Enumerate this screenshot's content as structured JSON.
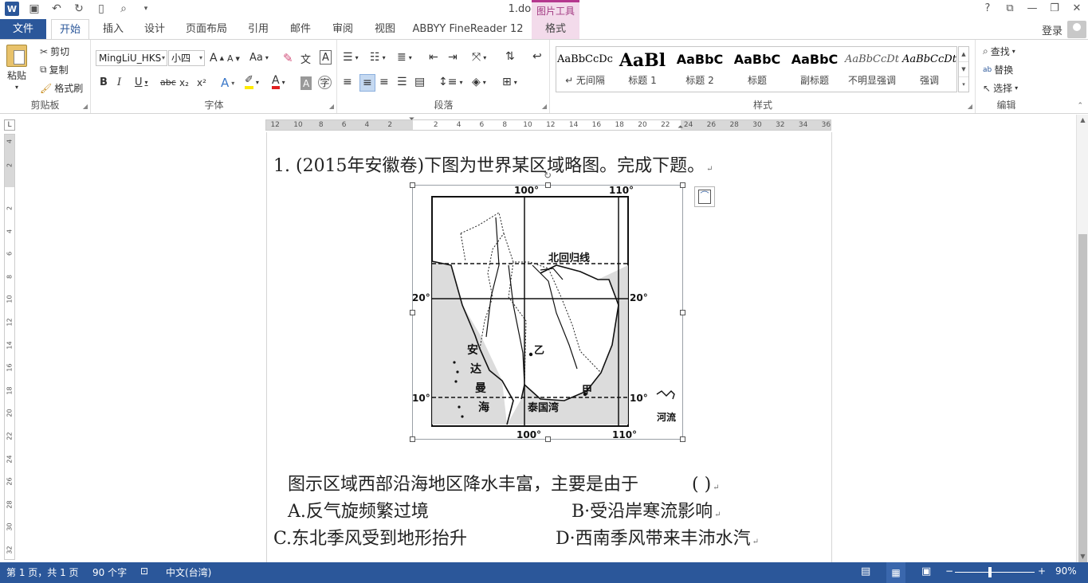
{
  "title_bar": {
    "doc_title": "1.docx - Word",
    "picture_tools": "图片工具",
    "controls": [
      "?",
      "⧉",
      "—",
      "❐",
      "✕"
    ]
  },
  "tabs": {
    "file": "文件",
    "items": [
      "开始",
      "插入",
      "设计",
      "页面布局",
      "引用",
      "邮件",
      "审阅",
      "视图",
      "ABBYY FineReader 12",
      "格式"
    ],
    "active": "开始",
    "login": "登录"
  },
  "ribbon": {
    "clipboard": {
      "paste": "粘贴",
      "cut": "剪切",
      "copy": "复制",
      "format_painter": "格式刷",
      "label": "剪贴板"
    },
    "font": {
      "name": "MingLiU_HKS",
      "size": "小四",
      "grow": "A",
      "shrink": "A",
      "case": "Aa",
      "bold": "B",
      "italic": "I",
      "underline": "U",
      "strike": "abc",
      "subscript": "x₂",
      "superscript": "x²",
      "label": "字体"
    },
    "paragraph": {
      "label": "段落"
    },
    "styles": {
      "items": [
        {
          "sample": "AaBbCcDc",
          "name": "↵ 无间隔"
        },
        {
          "sample": "AaBl",
          "name": "标题 1"
        },
        {
          "sample": "AaBbC",
          "name": "标题 2"
        },
        {
          "sample": "AaBbC",
          "name": "标题"
        },
        {
          "sample": "AaBbC",
          "name": "副标题"
        },
        {
          "sample": "AaBbCcDt",
          "name": "不明显强调"
        },
        {
          "sample": "AaBbCcDt",
          "name": "强调"
        }
      ],
      "label": "样式"
    },
    "editing": {
      "find": "查找",
      "replace": "替换",
      "select": "选择",
      "label": "编辑"
    }
  },
  "ruler": {
    "corner": "L",
    "ticks": [
      "12",
      "10",
      "8",
      "6",
      "4",
      "2",
      "2",
      "4",
      "6",
      "8",
      "10",
      "12",
      "14",
      "16",
      "18",
      "20",
      "22",
      "24",
      "26",
      "28",
      "30",
      "32",
      "34",
      "36"
    ],
    "vticks": [
      "4",
      "2",
      "2",
      "4",
      "6",
      "8",
      "10",
      "12",
      "14",
      "16",
      "18",
      "20",
      "22",
      "24",
      "26",
      "28",
      "30",
      "32"
    ]
  },
  "document": {
    "question": "1. (2015年安徽卷)下图为世界某区域略图。完成下题。",
    "stem": "图示区域西部沿海地区降水丰富，主要是由于",
    "stem_paren": "(    )",
    "option_a": "A.反气旋频繁过境",
    "option_b": "B·受沿岸寒流影响",
    "option_c": "C.东北季风受到地形抬升",
    "option_d": "D·西南季风带来丰沛水汽",
    "para_mark": "↵"
  },
  "map": {
    "lon_top_1": "100°",
    "lon_top_2": "110°",
    "lon_bottom_1": "100°",
    "lon_bottom_2": "110°",
    "lat_20_left": "20°",
    "lat_20_right": "20°",
    "lat_10_left": "10°",
    "lat_10_right": "10°",
    "tropic": "北回归线",
    "sea_chars": [
      "安",
      "达",
      "曼",
      "海"
    ],
    "gulf": "泰国湾",
    "point_yi": "乙",
    "point_jia": "甲",
    "legend_river": "河流"
  },
  "status": {
    "page": "第 1 页，共 1 页",
    "words": "90 个字",
    "language": "中文(台湾)",
    "zoom": "90%"
  }
}
